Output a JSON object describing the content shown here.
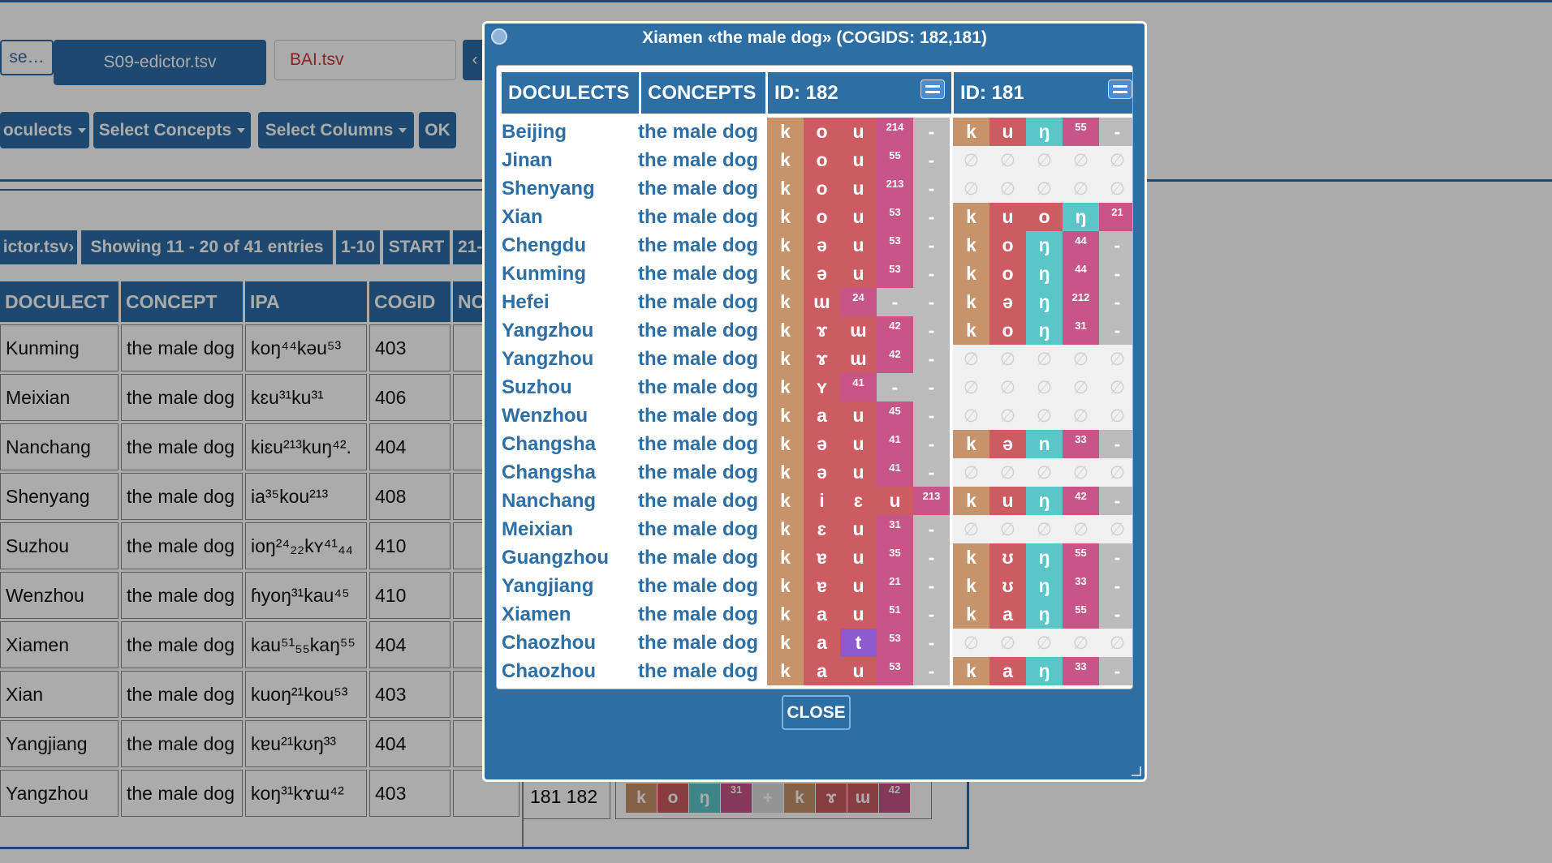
{
  "colors": {
    "accent": "#2d6ea5",
    "consonant": "#c6936a",
    "vowel": "#cc5c62",
    "tone": "#c75587",
    "nasal": "#5bc6c8",
    "gap": "#bbbbbb",
    "empty": "#f0f0f0",
    "special": "#8e5ad0"
  },
  "topbar": {
    "browse_label": "se…",
    "file_label": "S09-edictor.tsv",
    "file_input_value": "BAI.tsv",
    "nav_arrow": "‹"
  },
  "toolbar": {
    "doculects_label": "oculects",
    "concepts_label": "Select Concepts",
    "columns_label": "Select Columns",
    "ok_label": "OK"
  },
  "navbar": {
    "file_label": "ictor.tsv›",
    "showing_label": "Showing 11 - 20 of 41 entries",
    "prev_label": "1-10",
    "start_label": "START",
    "next_label": "21-"
  },
  "main_table": {
    "headers": [
      "DOCULECT",
      "CONCEPT",
      "IPA",
      "COGID",
      "NC"
    ],
    "rows": [
      [
        "Kunming",
        "the male dog",
        "koŋ⁴⁴kəu⁵³",
        "403"
      ],
      [
        "Meixian",
        "the male dog",
        "kɛu³¹ku³¹",
        "406"
      ],
      [
        "Nanchang",
        "the male dog",
        "kiɛu²¹³kuŋ⁴².",
        "404"
      ],
      [
        "Shenyang",
        "the male dog",
        "ia³⁵kou²¹³",
        "408"
      ],
      [
        "Suzhou",
        "the male dog",
        "ioŋ²⁴₂₂kʏ⁴¹₄₄",
        "410"
      ],
      [
        "Wenzhou",
        "the male dog",
        "ɦyoŋ³¹kau⁴⁵",
        "410"
      ],
      [
        "Xiamen",
        "the male dog",
        "kau⁵¹₅₅kaŋ⁵⁵",
        "404"
      ],
      [
        "Xian",
        "the male dog",
        "kuoŋ²¹kou⁵³",
        "403"
      ],
      [
        "Yangjiang",
        "the male dog",
        "kɐu²¹kʊŋ³³",
        "404"
      ],
      [
        "Yangzhou",
        "the male dog",
        "koŋ³¹kɤɯ⁴²",
        "403"
      ]
    ],
    "last_row_cogids": "181 182",
    "last_row_segments": [
      "k",
      "o",
      "ŋ",
      "31",
      "+",
      "k",
      "ɤ",
      "ɯ",
      "42"
    ]
  },
  "modal": {
    "title": "Xiamen «the male dog» (COGIDS: 182,181)",
    "headers": {
      "doculects": "DOCULECTS",
      "concepts": "CONCEPTS",
      "id1": "ID: 182",
      "id2": "ID: 181"
    },
    "close_label": "CLOSE",
    "empty_glyph": "∅",
    "rows": [
      {
        "doculect": "Beijing",
        "concept": "the male dog",
        "a": [
          "k",
          "o",
          "u",
          "214",
          "-"
        ],
        "b": [
          "k",
          "u",
          "ŋ",
          "55",
          "-"
        ]
      },
      {
        "doculect": "Jinan",
        "concept": "the male dog",
        "a": [
          "k",
          "o",
          "u",
          "55",
          "-"
        ],
        "b": null
      },
      {
        "doculect": "Shenyang",
        "concept": "the male dog",
        "a": [
          "k",
          "o",
          "u",
          "213",
          "-"
        ],
        "b": null
      },
      {
        "doculect": "Xian",
        "concept": "the male dog",
        "a": [
          "k",
          "o",
          "u",
          "53",
          "-"
        ],
        "b": [
          "k",
          "u",
          "o",
          "ŋ",
          "21"
        ]
      },
      {
        "doculect": "Chengdu",
        "concept": "the male dog",
        "a": [
          "k",
          "ə",
          "u",
          "53",
          "-"
        ],
        "b": [
          "k",
          "o",
          "ŋ",
          "44",
          "-"
        ]
      },
      {
        "doculect": "Kunming",
        "concept": "the male dog",
        "a": [
          "k",
          "ə",
          "u",
          "53",
          "-"
        ],
        "b": [
          "k",
          "o",
          "ŋ",
          "44",
          "-"
        ]
      },
      {
        "doculect": "Hefei",
        "concept": "the male dog",
        "a": [
          "k",
          "ɯ",
          "24",
          "-",
          "-"
        ],
        "b": [
          "k",
          "ə",
          "ŋ",
          "212",
          "-"
        ]
      },
      {
        "doculect": "Yangzhou",
        "concept": "the male dog",
        "a": [
          "k",
          "ɤ",
          "ɯ",
          "42",
          "-"
        ],
        "b": [
          "k",
          "o",
          "ŋ",
          "31",
          "-"
        ]
      },
      {
        "doculect": "Yangzhou",
        "concept": "the male dog",
        "a": [
          "k",
          "ɤ",
          "ɯ",
          "42",
          "-"
        ],
        "b": null
      },
      {
        "doculect": "Suzhou",
        "concept": "the male dog",
        "a": [
          "k",
          "ʏ",
          "41",
          "-",
          "-"
        ],
        "b": null
      },
      {
        "doculect": "Wenzhou",
        "concept": "the male dog",
        "a": [
          "k",
          "a",
          "u",
          "45",
          "-"
        ],
        "b": null
      },
      {
        "doculect": "Changsha",
        "concept": "the male dog",
        "a": [
          "k",
          "ə",
          "u",
          "41",
          "-"
        ],
        "b": [
          "k",
          "ə",
          "n",
          "33",
          "-"
        ]
      },
      {
        "doculect": "Changsha",
        "concept": "the male dog",
        "a": [
          "k",
          "ə",
          "u",
          "41",
          "-"
        ],
        "b": null
      },
      {
        "doculect": "Nanchang",
        "concept": "the male dog",
        "a": [
          "k",
          "i",
          "ɛ",
          "u",
          "213"
        ],
        "b": [
          "k",
          "u",
          "ŋ",
          "42",
          "-"
        ]
      },
      {
        "doculect": "Meixian",
        "concept": "the male dog",
        "a": [
          "k",
          "ɛ",
          "u",
          "31",
          "-"
        ],
        "b": null
      },
      {
        "doculect": "Guangzhou",
        "concept": "the male dog",
        "a": [
          "k",
          "ɐ",
          "u",
          "35",
          "-"
        ],
        "b": [
          "k",
          "ʊ",
          "ŋ",
          "55",
          "-"
        ]
      },
      {
        "doculect": "Yangjiang",
        "concept": "the male dog",
        "a": [
          "k",
          "ɐ",
          "u",
          "21",
          "-"
        ],
        "b": [
          "k",
          "ʊ",
          "ŋ",
          "33",
          "-"
        ]
      },
      {
        "doculect": "Xiamen",
        "concept": "the male dog",
        "a": [
          "k",
          "a",
          "u",
          "51",
          "-"
        ],
        "b": [
          "k",
          "a",
          "ŋ",
          "55",
          "-"
        ]
      },
      {
        "doculect": "Chaozhou",
        "concept": "the male dog",
        "a": [
          "k",
          "a",
          "t",
          "53",
          "-"
        ],
        "b": null
      },
      {
        "doculect": "Chaozhou",
        "concept": "the male dog",
        "a": [
          "k",
          "a",
          "u",
          "53",
          "-"
        ],
        "b": [
          "k",
          "a",
          "ŋ",
          "33",
          "-"
        ]
      }
    ]
  }
}
